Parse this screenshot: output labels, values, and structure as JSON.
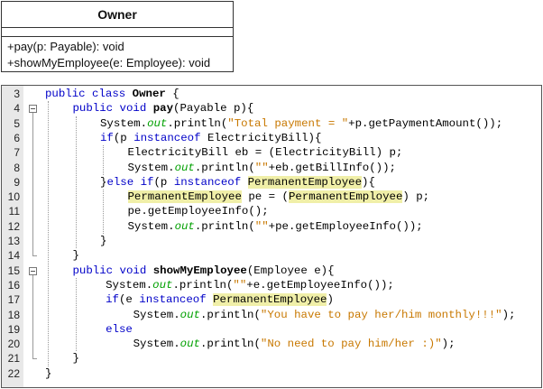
{
  "uml": {
    "class_name": "Owner",
    "operations": [
      "+pay(p: Payable): void",
      "+showMyEmployee(e: Employee): void"
    ]
  },
  "code": {
    "lines": [
      {
        "n": "3",
        "indent": 0,
        "tokens": [
          {
            "t": "public class ",
            "c": "kw"
          },
          {
            "t": "Owner",
            "c": "b"
          },
          {
            "t": " {"
          }
        ]
      },
      {
        "n": "4",
        "indent": 1,
        "tokens": [
          {
            "t": "public void ",
            "c": "kw"
          },
          {
            "t": "pay",
            "c": "b"
          },
          {
            "t": "(Payable p){"
          }
        ]
      },
      {
        "n": "5",
        "indent": 2,
        "tokens": [
          {
            "t": "System."
          },
          {
            "t": "out",
            "c": "fld"
          },
          {
            "t": ".println("
          },
          {
            "t": "\"Total payment = \"",
            "c": "str"
          },
          {
            "t": "+p.getPaymentAmount());"
          }
        ]
      },
      {
        "n": "6",
        "indent": 2,
        "tokens": [
          {
            "t": "if",
            "c": "kw"
          },
          {
            "t": "(p "
          },
          {
            "t": "instanceof",
            "c": "kw"
          },
          {
            "t": " ElectricityBill){"
          }
        ]
      },
      {
        "n": "7",
        "indent": 3,
        "tokens": [
          {
            "t": "ElectricityBill eb = (ElectricityBill) p;"
          }
        ]
      },
      {
        "n": "8",
        "indent": 3,
        "tokens": [
          {
            "t": "System."
          },
          {
            "t": "out",
            "c": "fld"
          },
          {
            "t": ".println("
          },
          {
            "t": "\"\"",
            "c": "str"
          },
          {
            "t": "+eb.getBillInfo());"
          }
        ]
      },
      {
        "n": "9",
        "indent": 2,
        "tokens": [
          {
            "t": "}"
          },
          {
            "t": "else if",
            "c": "kw"
          },
          {
            "t": "(p "
          },
          {
            "t": "instanceof",
            "c": "kw"
          },
          {
            "t": " "
          },
          {
            "t": "PermanentEmployee",
            "c": "hl"
          },
          {
            "t": "){"
          }
        ]
      },
      {
        "n": "10",
        "indent": 3,
        "tokens": [
          {
            "t": "PermanentEmployee",
            "c": "hl"
          },
          {
            "t": " pe = ("
          },
          {
            "t": "PermanentEmployee",
            "c": "hl"
          },
          {
            "t": ") p;"
          }
        ]
      },
      {
        "n": "11",
        "indent": 3,
        "tokens": [
          {
            "t": "pe.getEmployeeInfo();"
          }
        ]
      },
      {
        "n": "12",
        "indent": 3,
        "tokens": [
          {
            "t": "System."
          },
          {
            "t": "out",
            "c": "fld"
          },
          {
            "t": ".println("
          },
          {
            "t": "\"\"",
            "c": "str"
          },
          {
            "t": "+pe.getEmployeeInfo());"
          }
        ]
      },
      {
        "n": "13",
        "indent": 2,
        "tokens": [
          {
            "t": "}"
          }
        ]
      },
      {
        "n": "14",
        "indent": 1,
        "tokens": [
          {
            "t": "}"
          }
        ]
      },
      {
        "n": "15",
        "indent": 1,
        "tokens": [
          {
            "t": "public void ",
            "c": "kw"
          },
          {
            "t": "showMyEmployee",
            "c": "b"
          },
          {
            "t": "(Employee e){"
          }
        ]
      },
      {
        "n": "16",
        "indent": 2.2,
        "tokens": [
          {
            "t": "System."
          },
          {
            "t": "out",
            "c": "fld"
          },
          {
            "t": ".println("
          },
          {
            "t": "\"\"",
            "c": "str"
          },
          {
            "t": "+e.getEmployeeInfo());"
          }
        ]
      },
      {
        "n": "17",
        "indent": 2.2,
        "tokens": [
          {
            "t": "if",
            "c": "kw"
          },
          {
            "t": "(e "
          },
          {
            "t": "instanceof",
            "c": "kw"
          },
          {
            "t": " "
          },
          {
            "t": "PermanentEmployee",
            "c": "hl"
          },
          {
            "t": ")"
          }
        ]
      },
      {
        "n": "18",
        "indent": 3.2,
        "tokens": [
          {
            "t": "System."
          },
          {
            "t": "out",
            "c": "fld"
          },
          {
            "t": ".println("
          },
          {
            "t": "\"You have to pay her/him monthly!!!\"",
            "c": "str"
          },
          {
            "t": ");"
          }
        ]
      },
      {
        "n": "19",
        "indent": 2.2,
        "tokens": [
          {
            "t": "else",
            "c": "kw"
          }
        ]
      },
      {
        "n": "20",
        "indent": 3.2,
        "tokens": [
          {
            "t": "System."
          },
          {
            "t": "out",
            "c": "fld"
          },
          {
            "t": ".println("
          },
          {
            "t": "\"No need to pay him/her :)\"",
            "c": "str"
          },
          {
            "t": ");"
          }
        ]
      },
      {
        "n": "21",
        "indent": 1,
        "tokens": [
          {
            "t": "}"
          }
        ]
      },
      {
        "n": "22",
        "indent": 0,
        "tokens": [
          {
            "t": "}"
          }
        ]
      }
    ]
  }
}
